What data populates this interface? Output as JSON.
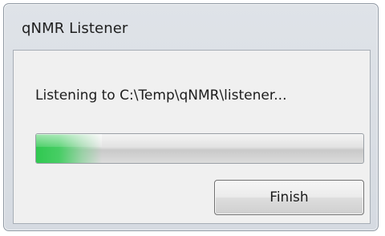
{
  "window": {
    "title": "qNMR Listener"
  },
  "dialog": {
    "message": "Listening to C:\\Temp\\qNMR\\listener...",
    "progress_fraction": 0.2,
    "progress_color": "#30c850",
    "finish_label": "Finish"
  }
}
